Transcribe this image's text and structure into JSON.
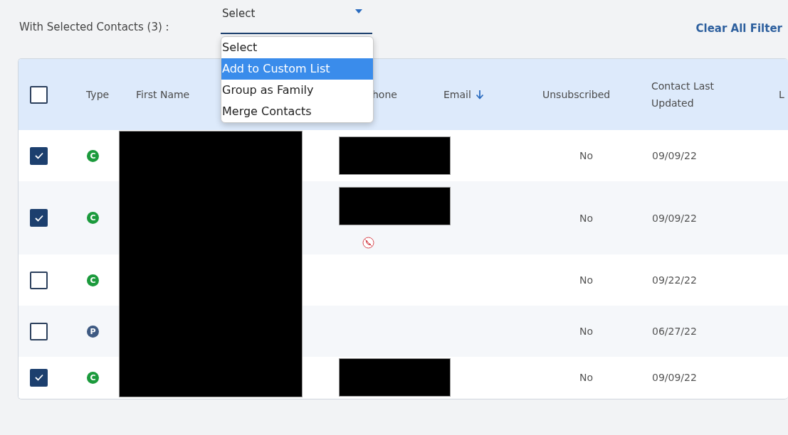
{
  "toolbar": {
    "label": "With Selected Contacts (3) :",
    "clear_filters": "Clear All Filter"
  },
  "dropdown": {
    "value": "Select",
    "expanded": true,
    "options": [
      {
        "label": "Select",
        "highlighted": false
      },
      {
        "label": "Add to Custom List",
        "highlighted": true
      },
      {
        "label": "Group as Family",
        "highlighted": false
      },
      {
        "label": "Merge Contacts",
        "highlighted": false
      }
    ]
  },
  "table": {
    "select_all": {
      "checked": false
    },
    "columns": [
      {
        "kind": "type",
        "label": "Type"
      },
      {
        "kind": "first_name",
        "label": "First Name"
      },
      {
        "kind": "phone",
        "label": "hone"
      },
      {
        "kind": "email",
        "label": "Email",
        "sorted": true
      },
      {
        "kind": "unsubscribed",
        "label": "Unsubscribed"
      },
      {
        "kind": "updated",
        "label": "Contact Last Updated"
      },
      {
        "kind": "column_9",
        "label": "L"
      }
    ],
    "names_redacted": true,
    "rows": [
      {
        "checked": true,
        "type": "C",
        "color": "#1b9a3c",
        "phone_redacted": true,
        "phone_blocked": false,
        "unsubscribed": "No",
        "updated": "09/09/22"
      },
      {
        "checked": true,
        "type": "C",
        "color": "#1b9a3c",
        "phone_redacted": true,
        "phone_blocked": true,
        "unsubscribed": "No",
        "updated": "09/09/22"
      },
      {
        "checked": false,
        "type": "C",
        "color": "#1b9a3c",
        "phone_redacted": false,
        "phone_blocked": false,
        "unsubscribed": "No",
        "updated": "09/22/22"
      },
      {
        "checked": false,
        "type": "P",
        "color": "#3e5a82",
        "phone_redacted": false,
        "phone_blocked": false,
        "unsubscribed": "No",
        "updated": "06/27/22"
      },
      {
        "checked": true,
        "type": "C",
        "color": "#1b9a3c",
        "phone_redacted": true,
        "phone_blocked": false,
        "unsubscribed": "No",
        "updated": "09/09/22"
      }
    ]
  }
}
